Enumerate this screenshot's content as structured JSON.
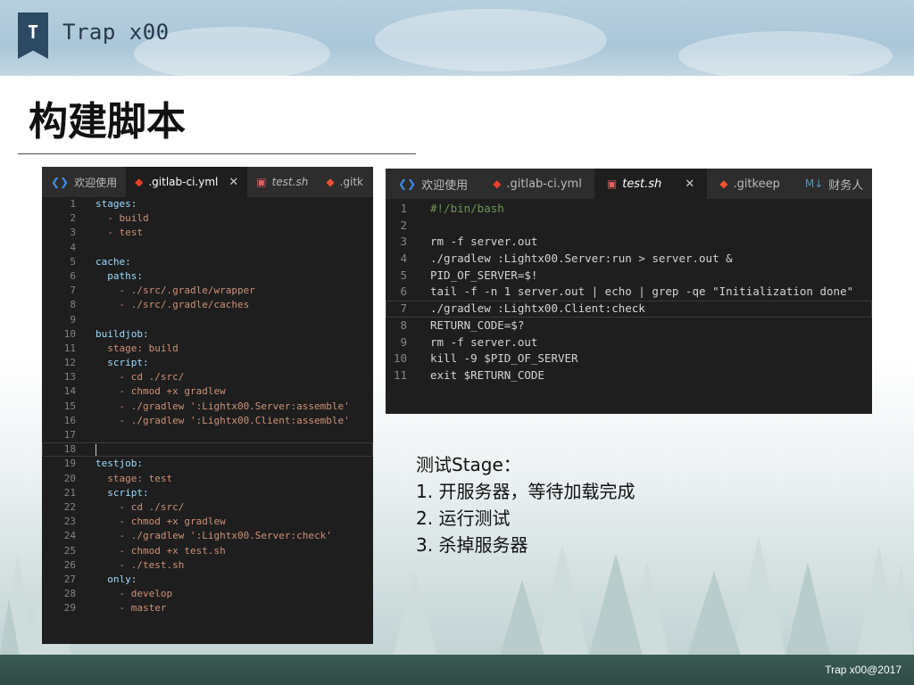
{
  "brand": {
    "badge_letter": "T",
    "title": "Trap x00"
  },
  "page": {
    "title": "构建脚本"
  },
  "left_editor": {
    "tabs": [
      {
        "label": "欢迎使用",
        "icon": "vscode-icon",
        "icon_color": "#3b8eea",
        "active": false,
        "closable": false
      },
      {
        "label": ".gitlab-ci.yml",
        "icon": "gitlab-icon",
        "icon_color": "#e2432a",
        "active": true,
        "closable": true
      },
      {
        "label": "test.sh",
        "icon": "terminal-icon",
        "icon_color": "#e25f5f",
        "active": false,
        "closable": false
      },
      {
        "label": ".gitk",
        "icon": "git-icon",
        "icon_color": "#f05133",
        "active": false,
        "closable": false
      }
    ],
    "close_glyph": "✕",
    "lines": [
      {
        "n": "1",
        "text": "stages:"
      },
      {
        "n": "2",
        "text": "  - build"
      },
      {
        "n": "3",
        "text": "  - test"
      },
      {
        "n": "4",
        "text": ""
      },
      {
        "n": "5",
        "text": "cache:"
      },
      {
        "n": "6",
        "text": "  paths:"
      },
      {
        "n": "7",
        "text": "    - ./src/.gradle/wrapper"
      },
      {
        "n": "8",
        "text": "    - ./src/.gradle/caches"
      },
      {
        "n": "9",
        "text": ""
      },
      {
        "n": "10",
        "text": "buildjob:"
      },
      {
        "n": "11",
        "text": "  stage: build"
      },
      {
        "n": "12",
        "text": "  script:"
      },
      {
        "n": "13",
        "text": "    - cd ./src/"
      },
      {
        "n": "14",
        "text": "    - chmod +x gradlew"
      },
      {
        "n": "15",
        "text": "    - ./gradlew ':Lightx00.Server:assemble'"
      },
      {
        "n": "16",
        "text": "    - ./gradlew ':Lightx00.Client:assemble'"
      },
      {
        "n": "17",
        "text": ""
      },
      {
        "n": "18",
        "text": ""
      },
      {
        "n": "19",
        "text": "testjob:"
      },
      {
        "n": "20",
        "text": "  stage: test"
      },
      {
        "n": "21",
        "text": "  script:"
      },
      {
        "n": "22",
        "text": "    - cd ./src/"
      },
      {
        "n": "23",
        "text": "    - chmod +x gradlew"
      },
      {
        "n": "24",
        "text": "    - ./gradlew ':Lightx00.Server:check'"
      },
      {
        "n": "25",
        "text": "    - chmod +x test.sh"
      },
      {
        "n": "26",
        "text": "    - ./test.sh"
      },
      {
        "n": "27",
        "text": "  only:"
      },
      {
        "n": "28",
        "text": "    - develop"
      },
      {
        "n": "29",
        "text": "    - master"
      }
    ]
  },
  "right_editor": {
    "tabs": [
      {
        "label": "欢迎使用",
        "icon": "vscode-icon",
        "icon_color": "#3b8eea",
        "active": false,
        "closable": false
      },
      {
        "label": ".gitlab-ci.yml",
        "icon": "gitlab-icon",
        "icon_color": "#e2432a",
        "active": false,
        "closable": false
      },
      {
        "label": "test.sh",
        "icon": "terminal-icon",
        "icon_color": "#e25f5f",
        "active": true,
        "closable": true
      },
      {
        "label": ".gitkeep",
        "icon": "git-icon",
        "icon_color": "#f05133",
        "active": false,
        "closable": false
      },
      {
        "label": "财务人",
        "icon": "markdown-icon",
        "icon_color": "#519aba",
        "active": false,
        "closable": false
      }
    ],
    "close_glyph": "✕",
    "lines": [
      {
        "n": "1",
        "text": "#!/bin/bash"
      },
      {
        "n": "2",
        "text": ""
      },
      {
        "n": "3",
        "text": "rm -f server.out"
      },
      {
        "n": "4",
        "text": "./gradlew :Lightx00.Server:run > server.out &"
      },
      {
        "n": "5",
        "text": "PID_OF_SERVER=$!"
      },
      {
        "n": "6",
        "text": "tail -f -n 1 server.out | echo | grep -qe \"Initialization done\""
      },
      {
        "n": "7",
        "text": "./gradlew :Lightx00.Client:check"
      },
      {
        "n": "8",
        "text": "RETURN_CODE=$?"
      },
      {
        "n": "9",
        "text": "rm -f server.out"
      },
      {
        "n": "10",
        "text": "kill -9 $PID_OF_SERVER"
      },
      {
        "n": "11",
        "text": "exit $RETURN_CODE"
      }
    ]
  },
  "notes": {
    "heading": "测试Stage：",
    "items": [
      "1. 开服务器，等待加载完成",
      "2. 运行测试",
      "3. 杀掉服务器"
    ]
  },
  "footer": {
    "text": "Trap x00@2017"
  }
}
